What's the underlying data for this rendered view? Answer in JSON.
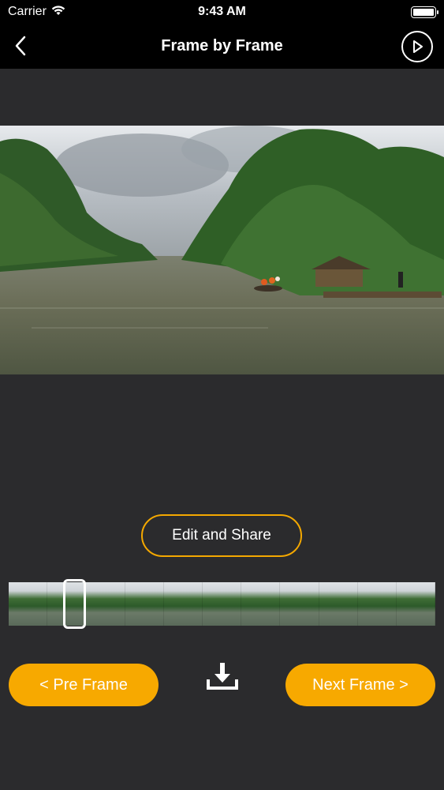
{
  "status_bar": {
    "carrier": "Carrier",
    "time": "9:43 AM"
  },
  "nav": {
    "title": "Frame by Frame",
    "back_icon": "chevron-left-icon",
    "play_icon": "play-circle-icon"
  },
  "preview": {
    "scene": "river-with-boats-and-trees"
  },
  "actions": {
    "edit_share_label": "Edit and Share",
    "pre_frame_label": "< Pre Frame",
    "next_frame_label": "Next Frame >",
    "download_icon": "download-icon"
  },
  "timeline": {
    "thumbnail_count": 11
  },
  "colors": {
    "accent": "#f7a900",
    "background": "#2b2b2d",
    "bar": "#000000"
  }
}
